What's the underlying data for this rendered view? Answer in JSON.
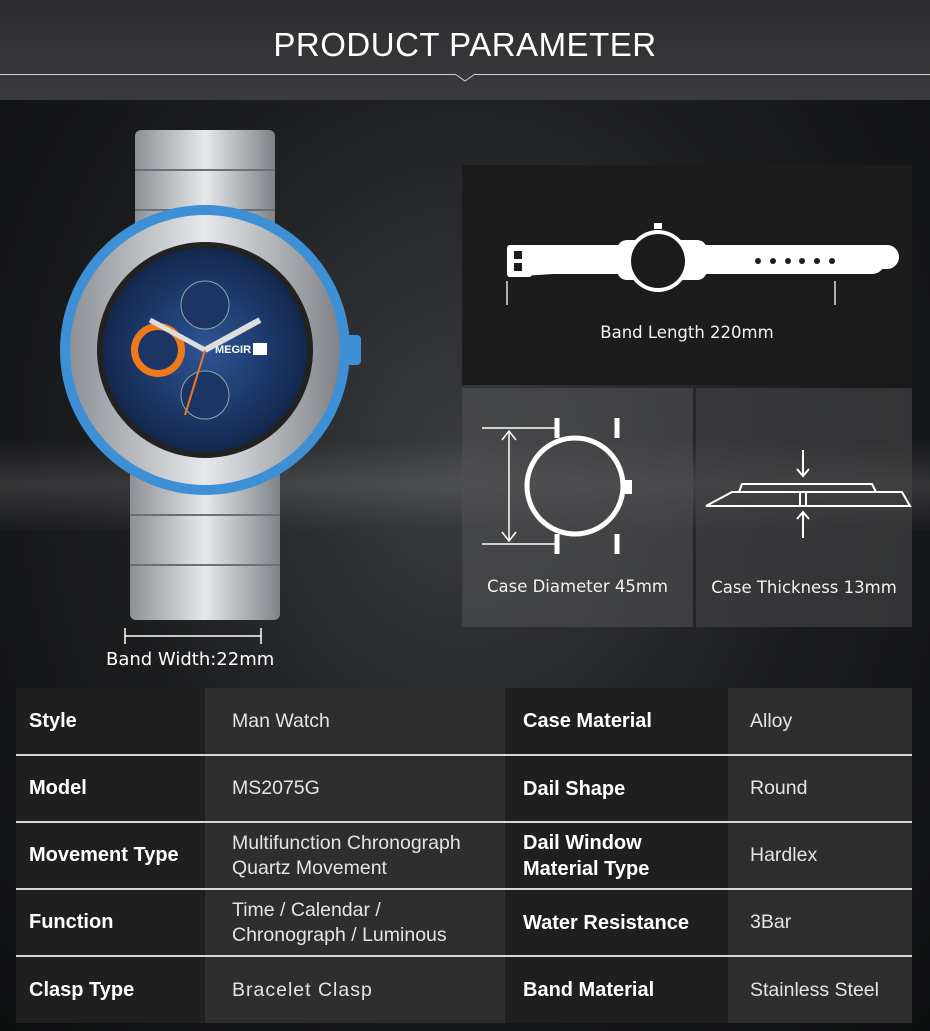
{
  "header": {
    "title": "PRODUCT PARAMETER"
  },
  "watch": {
    "brand_logo": "MEGIR",
    "dial_color": "#1f3f7a",
    "accent_color": "#f07a1a",
    "bezel_color": "#3d8fd6"
  },
  "dimensions": {
    "band_length": "Band Length 220mm",
    "case_diameter": "Case Diameter 45mm",
    "case_thickness": "Case Thickness 13mm",
    "band_width": "Band Width:22mm"
  },
  "specs": [
    {
      "label": "Style",
      "value": "Man Watch",
      "label2": "Case Material",
      "value2": "Alloy"
    },
    {
      "label": "Model",
      "value": "MS2075G",
      "label2": "Dail Shape",
      "value2": "Round"
    },
    {
      "label": "Movement Type",
      "value": "Multifunction Chronograph Quartz Movement",
      "label2": "Dail Window Material Type",
      "value2": "Hardlex"
    },
    {
      "label": "Function",
      "value": "Time  / Calendar / Chronograph / Luminous",
      "label2": "Water Resistance",
      "value2": "3Bar"
    },
    {
      "label": "Clasp Type",
      "value": "Bracelet Clasp",
      "label2": "Band Material",
      "value2": "Stainless Steel"
    }
  ]
}
